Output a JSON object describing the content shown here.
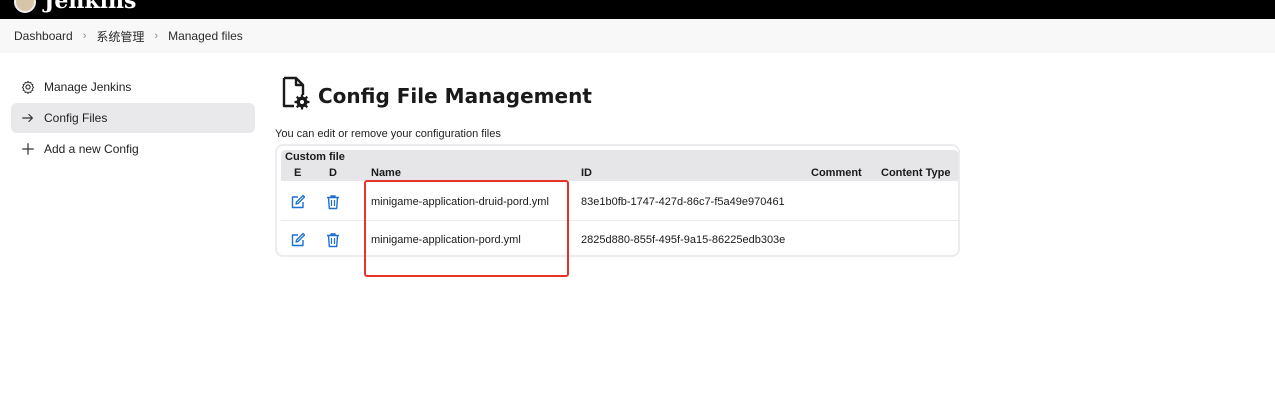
{
  "header": {
    "brand": "Jenkins"
  },
  "breadcrumb": [
    "Dashboard",
    "系统管理",
    "Managed files"
  ],
  "sidebar": {
    "items": [
      {
        "label": "Manage Jenkins",
        "icon": "gear-icon"
      },
      {
        "label": "Config Files",
        "icon": "arrow-right-icon",
        "active": true
      },
      {
        "label": "Add a new Config",
        "icon": "plus-icon"
      }
    ]
  },
  "main": {
    "title": "Config File Management",
    "description": "You can edit or remove your configuration files",
    "section_title": "Custom file",
    "columns": {
      "edit": "E",
      "delete": "D",
      "name": "Name",
      "id": "ID",
      "comment": "Comment",
      "content_type": "Content Type"
    },
    "rows": [
      {
        "name": "minigame-application-druid-pord.yml",
        "id": "83e1b0fb-1747-427d-86c7-f5a49e970461",
        "comment": "",
        "content_type": ""
      },
      {
        "name": "minigame-application-pord.yml",
        "id": "2825d880-855f-495f-9a15-86225edb303e",
        "comment": "",
        "content_type": ""
      }
    ]
  },
  "colors": {
    "accent_blue": "#1f6fd1",
    "highlight_red": "#e5332a",
    "topbar": "#000000"
  }
}
